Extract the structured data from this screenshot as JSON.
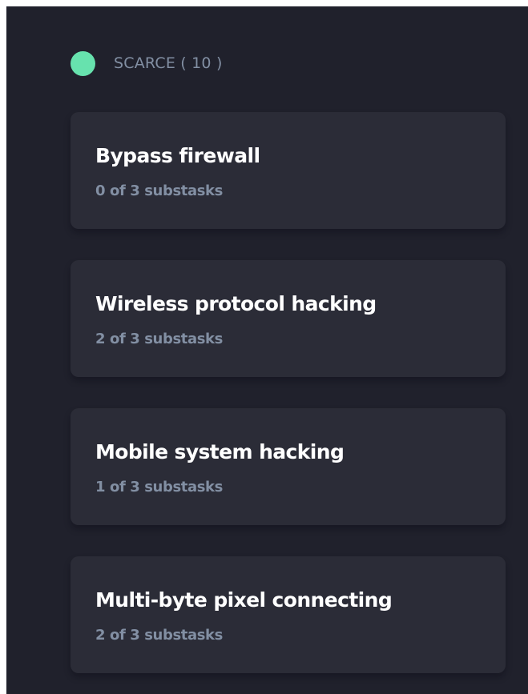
{
  "column": {
    "title": "SCARCE ( 10 )",
    "dot_color": "#67e2ae",
    "tasks": [
      {
        "title": "Bypass firewall",
        "subtitle": "0 of 3 substasks"
      },
      {
        "title": "Wireless protocol hacking",
        "subtitle": "2 of 3 substasks"
      },
      {
        "title": "Mobile system hacking",
        "subtitle": "1 of 3 substasks"
      },
      {
        "title": "Multi-byte pixel connecting",
        "subtitle": "2 of 3 substasks"
      }
    ]
  }
}
